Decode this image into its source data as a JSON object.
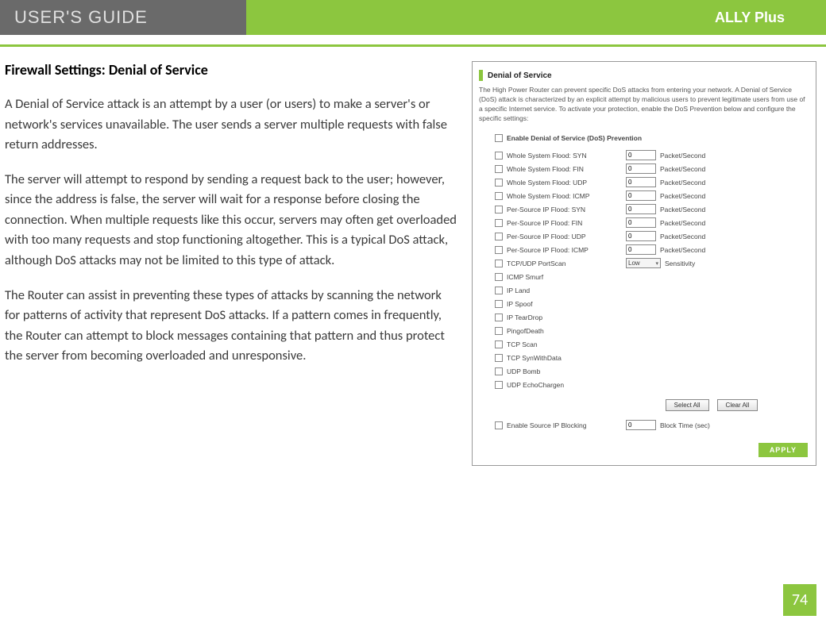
{
  "header": {
    "guide_label": "USER'S GUIDE",
    "product_label": "ALLY Plus"
  },
  "page": {
    "title": "Firewall Settings: Denial of Service",
    "para1": "A Denial of Service attack is an attempt by a user (or users) to make a server's or network's services unavailable. The user sends a server multiple requests with false return addresses.",
    "para2": "The server will attempt to respond by sending a request back to the user; however, since the address is false, the server will wait for a response before closing the connection. When multiple requests like this occur, servers may often get overloaded with too many requests and stop functioning altogether. This is a typical DoS attack, although DoS attacks may not be limited to this type of attack.",
    "para3": "The Router can assist in preventing these types of attacks by scanning the network for patterns of activity that represent DoS attacks. If a pattern comes in frequently, the Router can attempt to block messages containing that pattern and thus protect the server from becoming overloaded and unresponsive.",
    "page_number": "74"
  },
  "panel": {
    "title": "Denial of Service",
    "description": "The High Power Router can prevent specific DoS attacks from entering your network. A Denial of Service (DoS) attack is characterized by an explicit attempt by malicious users to prevent legitimate users from use of a specific Internet service. To activate your protection, enable the DoS Prevention below and configure the specific settings:",
    "enable_header": "Enable Denial of Service (DoS) Prevention",
    "flood_rows": [
      {
        "label": "Whole System Flood: SYN",
        "value": "0",
        "unit": "Packet/Second"
      },
      {
        "label": "Whole System Flood: FIN",
        "value": "0",
        "unit": "Packet/Second"
      },
      {
        "label": "Whole System Flood: UDP",
        "value": "0",
        "unit": "Packet/Second"
      },
      {
        "label": "Whole System Flood: ICMP",
        "value": "0",
        "unit": "Packet/Second"
      },
      {
        "label": "Per-Source IP Flood: SYN",
        "value": "0",
        "unit": "Packet/Second"
      },
      {
        "label": "Per-Source IP Flood: FIN",
        "value": "0",
        "unit": "Packet/Second"
      },
      {
        "label": "Per-Source IP Flood: UDP",
        "value": "0",
        "unit": "Packet/Second"
      },
      {
        "label": "Per-Source IP Flood: ICMP",
        "value": "0",
        "unit": "Packet/Second"
      }
    ],
    "portscan": {
      "label": "TCP/UDP PortScan",
      "select": "Low",
      "unit": "Sensitivity"
    },
    "simple_rows": [
      {
        "label": "ICMP Smurf"
      },
      {
        "label": "IP Land"
      },
      {
        "label": "IP Spoof"
      },
      {
        "label": "IP TearDrop"
      },
      {
        "label": "PingofDeath"
      },
      {
        "label": "TCP Scan"
      },
      {
        "label": "TCP SynWithData"
      },
      {
        "label": "UDP Bomb"
      },
      {
        "label": "UDP EchoChargen"
      }
    ],
    "select_all": "Select All",
    "clear_all": "Clear All",
    "source_ip": {
      "label": "Enable Source IP Blocking",
      "value": "0",
      "unit": "Block Time (sec)"
    },
    "apply": "APPLY"
  }
}
